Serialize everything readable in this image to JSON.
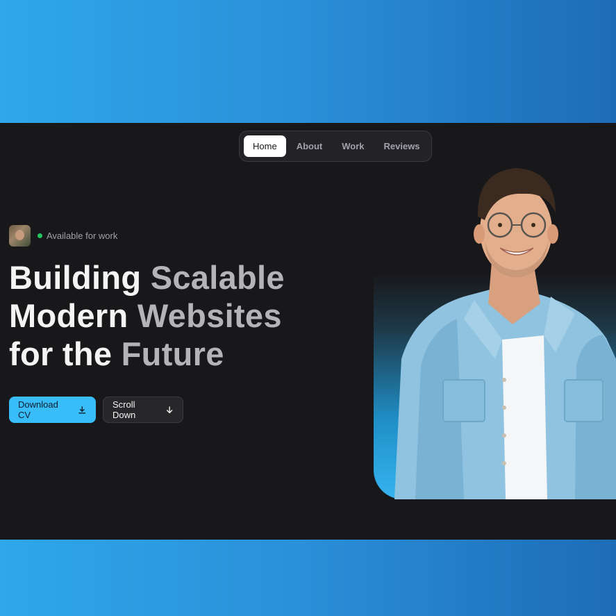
{
  "nav": {
    "items": [
      {
        "label": "Home",
        "active": true
      },
      {
        "label": "About",
        "active": false
      },
      {
        "label": "Work",
        "active": false
      },
      {
        "label": "Reviews",
        "active": false
      }
    ]
  },
  "status": {
    "text": "Available for work",
    "dot_color": "#22c55e"
  },
  "hero": {
    "line1_a": "Building",
    "line1_b": "Scalable",
    "line2_a": "Modern",
    "line2_b": "Websites",
    "line3_a": "for the",
    "line3_b": "Future"
  },
  "actions": {
    "primary_label": "Download CV",
    "primary_icon": "download-icon",
    "secondary_label": "Scroll Down",
    "secondary_icon": "arrow-down-icon"
  },
  "colors": {
    "accent": "#38bdf8",
    "background": "#18181b"
  }
}
